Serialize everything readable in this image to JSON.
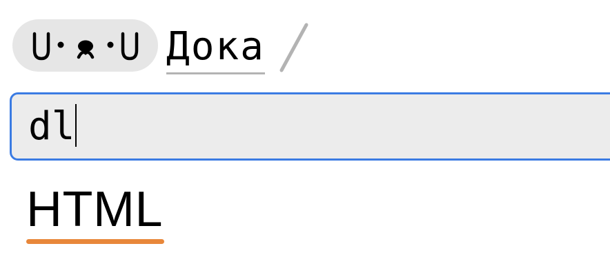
{
  "header": {
    "logo_text": "U•ᴥ•U",
    "section_link_label": "Дока",
    "breadcrumb_separator": "/"
  },
  "search": {
    "value": "dl",
    "focused": true
  },
  "results": [
    {
      "label": "HTML",
      "accent_color": "#e8873a"
    }
  ],
  "colors": {
    "focus_border": "#3b7be3",
    "input_background": "#ececec",
    "pill_background": "#e6e6e6",
    "link_underline": "#b3b3b3",
    "slash": "#b3b3b3",
    "result_accent": "#e8873a"
  }
}
